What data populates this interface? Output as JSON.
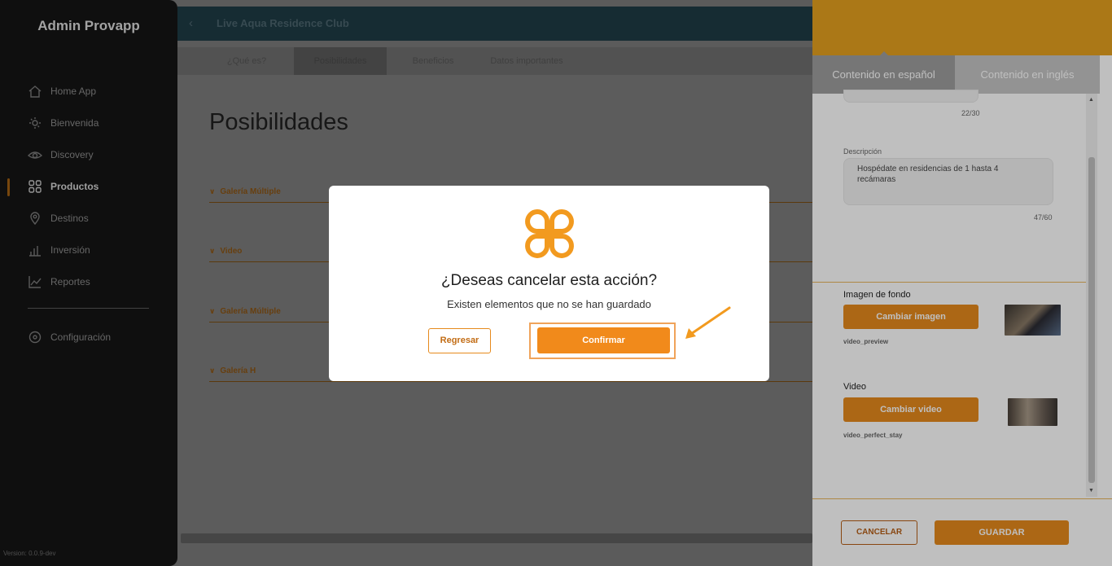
{
  "sidebar": {
    "brand": "Admin Provapp",
    "items": [
      {
        "label": "Home App",
        "icon": "home-icon"
      },
      {
        "label": "Bienvenida",
        "icon": "bienvenida-icon"
      },
      {
        "label": "Discovery",
        "icon": "discovery-icon"
      },
      {
        "label": "Productos",
        "icon": "grid-icon",
        "active": true
      },
      {
        "label": "Destinos",
        "icon": "location-pin-icon"
      },
      {
        "label": "Inversión",
        "icon": "bar-chart-icon"
      },
      {
        "label": "Reportes",
        "icon": "line-chart-icon"
      }
    ],
    "settings": {
      "label": "Configuración",
      "icon": "gear-icon"
    },
    "version": "Version: 0.0.9-dev"
  },
  "header": {
    "back_icon": "chevron-left-icon",
    "title": "Live Aqua Residence Club"
  },
  "tabs": [
    "¿Qué es?",
    "Posibilidades",
    "Beneficios",
    "Datos importantes"
  ],
  "main": {
    "heading": "Posibilidades",
    "sections": [
      "Galería Múltiple",
      "Video",
      "Galería Múltiple",
      "Galería H"
    ]
  },
  "right_panel": {
    "tab_es": "Contenido en español",
    "tab_en": "Contenido en inglés",
    "title_counter": "22/30",
    "description_label": "Descripción",
    "description_value": "Hospédate en residencias de 1 hasta 4 recámaras",
    "description_counter": "47/60",
    "background_label": "Imagen de fondo",
    "change_image": "Cambiar imagen",
    "image_file": "video_preview",
    "video_label": "Video",
    "change_video": "Cambiar video",
    "video_file": "video_perfect_stay",
    "cancel": "CANCELAR",
    "save": "GUARDAR"
  },
  "modal": {
    "logo_icon": "provapp-clover-icon",
    "question": "¿Deseas cancelar esta acción?",
    "message": "Existen elementos que no se han guardado",
    "back_button": "Regresar",
    "confirm_button": "Confirmar"
  },
  "colors": {
    "accent": "#f18a1b",
    "gold": "#e5a11f",
    "sidebar": "#141414"
  }
}
